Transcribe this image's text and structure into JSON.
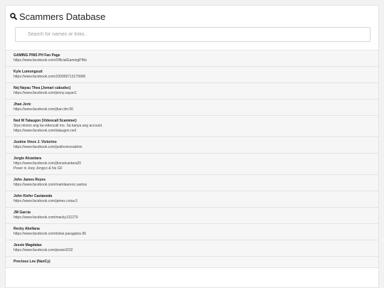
{
  "header": {
    "title": "Scammers Database",
    "icon": "search-icon"
  },
  "search": {
    "placeholder": "Search for names or links..",
    "value": ""
  },
  "entries": [
    {
      "name": "GAMING PINS PH Fan Page",
      "lines": [
        "https://www.facebook.com/OfficialGamingPINs"
      ]
    },
    {
      "name": "Kyle Lumongsud",
      "lines": [
        "https://www.facebook.com/100009713179006"
      ]
    },
    {
      "name": "Nej Nayau Thea (Jomari cabudoc)",
      "lines": [
        "https://www.facebook.com/jenny.sayan1"
      ]
    },
    {
      "name": "Jhan Jeric",
      "lines": [
        "https://www.facebook.com/jhan.tim.50"
      ]
    },
    {
      "name": "Ned M Talaugon (Videocall Scammer)",
      "lines": [
        "Siya mismo ang ka-videocall mo. Sa kanya ang account.",
        "https://www.facebook.com/talaugon.neil"
      ]
    },
    {
      "name": "Justine Vince J. Victorino",
      "lines": [
        "https://www.facebook.com/justinvinceadmin"
      ]
    },
    {
      "name": "Jorgie Alcantara",
      "lines": [
        "https://www.facebook.com/jhonalcantara20",
        "Poser ni Joey Jongco & his GF"
      ]
    },
    {
      "name": "John James Reyes",
      "lines": [
        "https://www.facebook.com/marklaurenz.santos"
      ]
    },
    {
      "name": "John Kiefer Castaneda",
      "lines": [
        "https://www.facebook.com/james.coisa.5"
      ]
    },
    {
      "name": "JM Garcia",
      "lines": [
        "https://www.facebook.com/macky131279"
      ]
    },
    {
      "name": "Recky Abellana",
      "lines": [
        "https://www.facebook.com/totsie.paragatos.96"
      ]
    },
    {
      "name": "Jessie Magdalao",
      "lines": [
        "https://www.facebook.com/jessie3232"
      ]
    },
    {
      "name": "Precious Lee (NanCy)",
      "lines": []
    }
  ]
}
